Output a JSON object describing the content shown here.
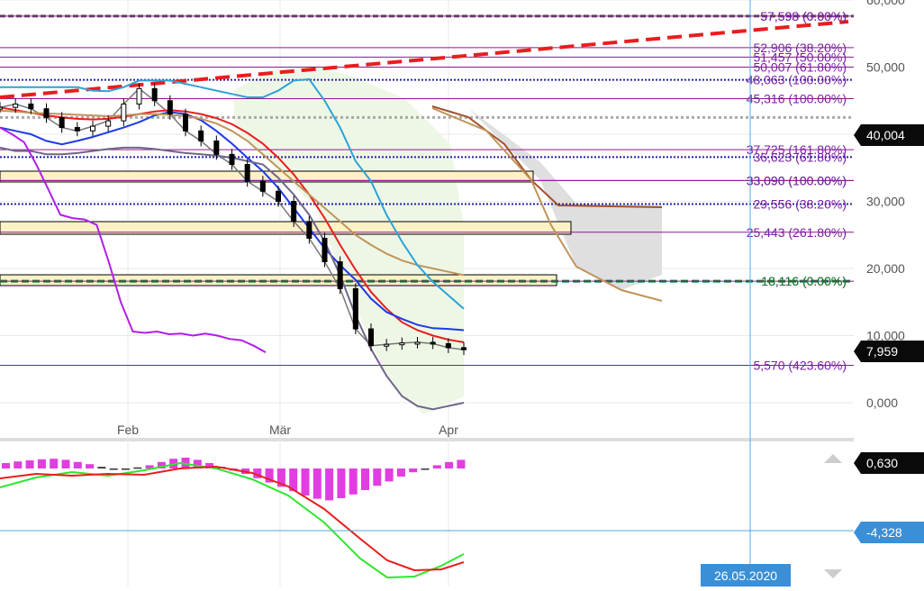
{
  "colors": {
    "fib": "#8b1a8b",
    "fib_label": "#7a1fa2",
    "grid": "#eaeaea",
    "axis_text": "#555555",
    "resistance": "#e81e1e",
    "ichimoku_cloud": "#d9d9d9",
    "bollinger_fill": "#eef7e6",
    "zone_fill": "#fdf1c6",
    "price_badge": "#0a0a0a",
    "cursor": "#5aa7e0",
    "cursor_badge": "#3b8fd6",
    "macd_hist": "#e13ee0",
    "macd_line": "#2ee62e",
    "signal_line": "#e81e1e"
  },
  "axis": {
    "y_ticks": [
      "60,000",
      "50,000",
      "40,000",
      "30,000",
      "20,000",
      "10,000",
      "0,000"
    ],
    "y_tick_values": [
      60,
      50,
      40,
      30,
      20,
      10,
      0
    ],
    "x_ticks": [
      "Feb",
      "Mär",
      "Apr"
    ]
  },
  "badges": {
    "price_upper": "40,004",
    "price_last": "7,959",
    "macd_value": "0,630",
    "macd_signal": "-4,328",
    "cursor_date": "26.05.2020"
  },
  "fib_levels": [
    {
      "label": "57,598 (0.00%)",
      "value": 57.6
    },
    {
      "label": "57,598 (0.00%)",
      "value": 57.6
    },
    {
      "label": "52,906 (38.20%)",
      "value": 52.9
    },
    {
      "label": "51,457 (50.00%)",
      "value": 51.5
    },
    {
      "label": "50,007 (61.80%)",
      "value": 50.0
    },
    {
      "label": "48,063 (100.00%)",
      "value": 48.1
    },
    {
      "label": "45,316 (100.00%)",
      "value": 45.3
    },
    {
      "label": "37,725 (161.80%)",
      "value": 37.7
    },
    {
      "label": "36,623 (61.80%)",
      "value": 36.6
    },
    {
      "label": "33,090 (100.00%)",
      "value": 33.1
    },
    {
      "label": "33,090 (100.00%)",
      "value": 33.1
    },
    {
      "label": "29,556 (38.20%)",
      "value": 29.6
    },
    {
      "label": "25,443 (261.80%)",
      "value": 25.4
    },
    {
      "label": "18,116 (0.00%)",
      "value": 18.1
    },
    {
      "label": "18,116 (0.00%)",
      "value": 18.1
    },
    {
      "label": "5,570 (423.60%)",
      "value": 5.57
    }
  ],
  "chart_data": {
    "type": "line",
    "x": [
      "Feb",
      "Mär",
      "Apr"
    ],
    "ylim": [
      -2,
      62
    ],
    "y_scale": "linear",
    "grid": true,
    "legend": "none",
    "series": [
      {
        "values": [
          44.0,
          44.5,
          43.8,
          42.5,
          41.0,
          40.5,
          41.2,
          42.0,
          44.5,
          46.8,
          45.0,
          43.0,
          40.5,
          39.0,
          37.0,
          35.5,
          33.0,
          31.5,
          30.0,
          27.0,
          24.5,
          21.0,
          17.0,
          11.0,
          8.5,
          8.7,
          8.9,
          9.0,
          8.8,
          8.2,
          7.9
        ]
      },
      {
        "values": [
          44.0,
          43.6,
          43.2,
          42.8,
          42.5,
          42.3,
          42.2,
          42.3,
          42.6,
          43.0,
          43.4,
          43.6,
          43.4,
          43.0,
          42.4,
          41.5,
          40.2,
          38.6,
          36.5,
          34.0,
          31.0,
          27.5,
          23.5,
          19.8,
          16.5,
          14.0,
          12.0,
          10.8,
          10.0,
          9.4,
          9.0
        ]
      },
      {
        "values": [
          41.0,
          40.5,
          40.0,
          39.0,
          38.5,
          39.0,
          39.6,
          40.3,
          41.0,
          41.8,
          42.8,
          43.3,
          43.0,
          42.1,
          40.5,
          38.6,
          36.5,
          34.5,
          32.0,
          29.0,
          26.0,
          23.0,
          20.5,
          18.3,
          15.5,
          13.5,
          12.5,
          11.6,
          11.1,
          11.0,
          10.8
        ]
      },
      {
        "values": [
          43.5,
          43.4,
          43.2,
          43.1,
          43.0,
          42.9,
          42.8,
          42.7,
          42.8,
          43.0,
          43.0,
          42.9,
          42.7,
          42.3,
          41.6,
          40.5,
          39.0,
          37.0,
          35.0,
          33.0,
          31.0,
          29.0,
          27.0,
          25.0,
          23.5,
          22.2,
          21.2,
          20.5,
          20.0,
          19.5,
          19.0
        ]
      },
      {
        "values": [
          47.0,
          47.0,
          47.0,
          47.0,
          47.0,
          47.0,
          46.5,
          46.4,
          47.0,
          48.0,
          48.0,
          48.0,
          47.5,
          47.0,
          46.5,
          46.0,
          45.5,
          45.5,
          46.5,
          48.0,
          48.2,
          45.0,
          41.0,
          36.0,
          33.0,
          28.0,
          24.0,
          20.5,
          18.0,
          16.0,
          14.0
        ]
      },
      {
        "values": [
          38.0,
          37.5,
          37.5,
          37.0,
          37.0,
          37.2,
          37.5,
          37.8,
          38.0,
          38.0,
          37.8,
          37.5,
          37.2,
          37.0,
          36.8,
          36.5,
          36.0,
          35.5,
          33.5,
          31.0,
          28.0,
          24.0,
          19.0,
          13.0,
          8.0,
          4.0,
          1.0,
          -0.5,
          -1.0,
          -0.5,
          0.0
        ]
      },
      {
        "values": [
          41.0,
          40.0,
          38.8,
          35.5,
          31.8,
          28.0,
          27.5,
          27.3,
          26.5,
          21.0,
          15.0,
          10.6,
          10.4,
          10.6,
          10.2,
          10.3,
          10.0,
          10.3,
          10.0,
          9.5,
          9.3,
          8.5,
          7.5
        ]
      }
    ]
  }
}
